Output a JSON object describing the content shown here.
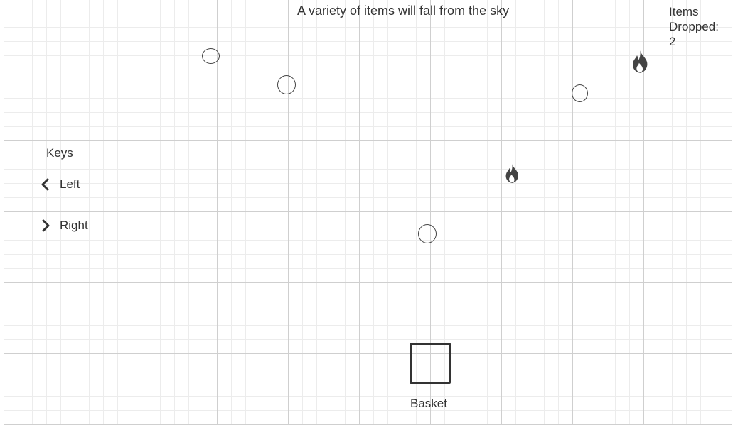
{
  "game": {
    "title": "A variety of items will fall from the sky",
    "items_dropped_label": "Items Dropped:",
    "items_dropped_value": "2"
  },
  "controls": {
    "heading": "Keys",
    "left_label": "Left",
    "right_label": "Right",
    "left_icon": "chevron-left-icon",
    "right_icon": "chevron-right-icon"
  },
  "player": {
    "basket_label": "Basket"
  },
  "falling_items": [
    {
      "kind": "ball",
      "icon": "circle-icon"
    },
    {
      "kind": "ball",
      "icon": "circle-icon"
    },
    {
      "kind": "ball",
      "icon": "circle-icon"
    },
    {
      "kind": "ball",
      "icon": "circle-icon"
    },
    {
      "kind": "fire",
      "icon": "flame-icon"
    },
    {
      "kind": "fire",
      "icon": "flame-icon"
    }
  ],
  "colors": {
    "grid_major": "#cfcfcf",
    "grid_minor": "#ececec",
    "ink": "#333333",
    "flame": "#444444"
  }
}
